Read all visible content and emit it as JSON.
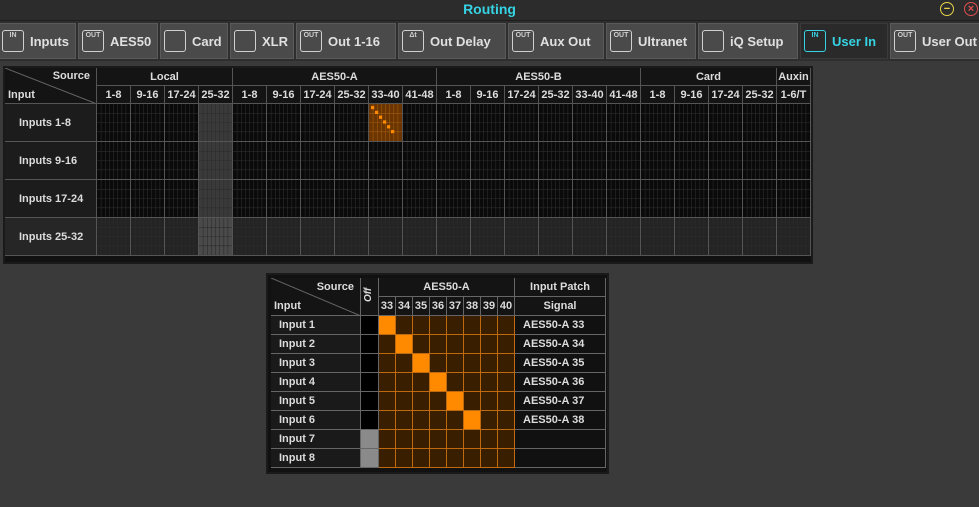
{
  "window": {
    "title": "Routing",
    "minimize_symbol": "−",
    "close_symbol": "×"
  },
  "tabs": [
    {
      "label": "Inputs",
      "icon": "input-icon",
      "icon_text": "IN"
    },
    {
      "label": "AES50",
      "icon": "output-icon",
      "icon_text": "OUT"
    },
    {
      "label": "Card",
      "icon": "card-icon",
      "icon_text": ""
    },
    {
      "label": "XLR",
      "icon": "xlr-icon",
      "icon_text": ""
    },
    {
      "label": "Out 1-16",
      "icon": "output-icon",
      "icon_text": "OUT"
    },
    {
      "label": "Out Delay",
      "icon": "delay-icon",
      "icon_text": "Δt"
    },
    {
      "label": "Aux Out",
      "icon": "output-icon",
      "icon_text": "OUT"
    },
    {
      "label": "Ultranet",
      "icon": "output-icon",
      "icon_text": "OUT"
    },
    {
      "label": "iQ Setup",
      "icon": "speaker-icon",
      "icon_text": ""
    },
    {
      "label": "User In",
      "icon": "input-icon",
      "icon_text": "IN",
      "active": true
    },
    {
      "label": "User Out",
      "icon": "output-icon",
      "icon_text": "OUT"
    }
  ],
  "routing_matrix": {
    "corner_source": "Source",
    "corner_input": "Input",
    "groups": [
      {
        "name": "Local",
        "columns": [
          "1-8",
          "9-16",
          "17-24",
          "25-32"
        ]
      },
      {
        "name": "AES50-A",
        "columns": [
          "1-8",
          "9-16",
          "17-24",
          "25-32",
          "33-40",
          "41-48"
        ]
      },
      {
        "name": "AES50-B",
        "columns": [
          "1-8",
          "9-16",
          "17-24",
          "25-32",
          "33-40",
          "41-48"
        ]
      },
      {
        "name": "Card",
        "columns": [
          "1-8",
          "9-16",
          "17-24",
          "25-32"
        ]
      },
      {
        "name": "Auxin",
        "columns": [
          "1-6/T"
        ]
      }
    ],
    "rows": [
      "Inputs 1-8",
      "Inputs 9-16",
      "Inputs 17-24",
      "Inputs 25-32"
    ],
    "highlight": {
      "row": "Inputs 1-8",
      "group": "AES50-A",
      "column": "33-40"
    }
  },
  "patch_detail": {
    "corner_source": "Source",
    "corner_input": "Input",
    "off_label": "Off",
    "group_label": "AES50-A",
    "columns": [
      "33",
      "34",
      "35",
      "36",
      "37",
      "38",
      "39",
      "40"
    ],
    "patch_header": "Input Patch",
    "signal_header": "Signal",
    "rows": [
      {
        "label": "Input 1",
        "routed": "33",
        "signal": "AES50-A 33"
      },
      {
        "label": "Input 2",
        "routed": "34",
        "signal": "AES50-A 34"
      },
      {
        "label": "Input 3",
        "routed": "35",
        "signal": "AES50-A 35"
      },
      {
        "label": "Input 4",
        "routed": "36",
        "signal": "AES50-A 36"
      },
      {
        "label": "Input 5",
        "routed": "37",
        "signal": "AES50-A 37"
      },
      {
        "label": "Input 6",
        "routed": "38",
        "signal": "AES50-A 38"
      },
      {
        "label": "Input 7",
        "routed": "",
        "signal": ""
      },
      {
        "label": "Input 8",
        "routed": "",
        "signal": ""
      }
    ]
  },
  "colors": {
    "accent": "#35d3e4",
    "route_on": "#ff8a00",
    "route_off": "#3a1e00"
  }
}
